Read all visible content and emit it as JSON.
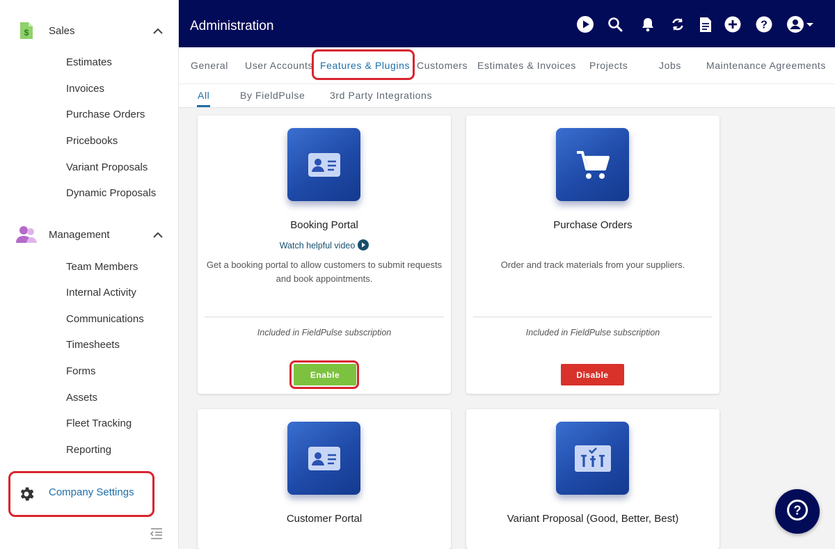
{
  "sidebar": {
    "sections": [
      {
        "label": "Sales",
        "icon": "dollar-document-icon",
        "items": [
          "Estimates",
          "Invoices",
          "Purchase Orders",
          "Pricebooks",
          "Variant Proposals",
          "Dynamic Proposals"
        ]
      },
      {
        "label": "Management",
        "icon": "people-icon",
        "items": [
          "Team Members",
          "Internal Activity",
          "Communications",
          "Timesheets",
          "Forms",
          "Assets",
          "Fleet Tracking",
          "Reporting"
        ]
      }
    ],
    "company_settings": "Company Settings"
  },
  "header": {
    "title": "Administration"
  },
  "tabs": [
    "General",
    "User Accounts",
    "Features & Plugins",
    "Customers",
    "Estimates & Invoices",
    "Projects",
    "Jobs",
    "Maintenance Agreements"
  ],
  "active_tab": "Features & Plugins",
  "subtabs": [
    "All",
    "By FieldPulse",
    "3rd Party Integrations"
  ],
  "active_subtab": "All",
  "cards": [
    {
      "title": "Booking Portal",
      "video_link": "Watch helpful video",
      "description": "Get a booking portal to allow customers to submit requests and book appointments.",
      "included": "Included in FieldPulse subscription",
      "button": "Enable",
      "icon": "id-card-icon"
    },
    {
      "title": "Purchase Orders",
      "description": "Order and track materials from your suppliers.",
      "included": "Included in FieldPulse subscription",
      "button": "Disable",
      "icon": "shopping-cart-icon"
    },
    {
      "title": "Customer Portal",
      "icon": "id-card-icon"
    },
    {
      "title": "Variant Proposal (Good, Better, Best)",
      "icon": "comparison-icon"
    }
  ],
  "colors": {
    "navy": "#020b58",
    "link": "#1c6fa8",
    "enable": "#7dc23f",
    "disable": "#d8322b",
    "highlight": "#d9252e"
  }
}
